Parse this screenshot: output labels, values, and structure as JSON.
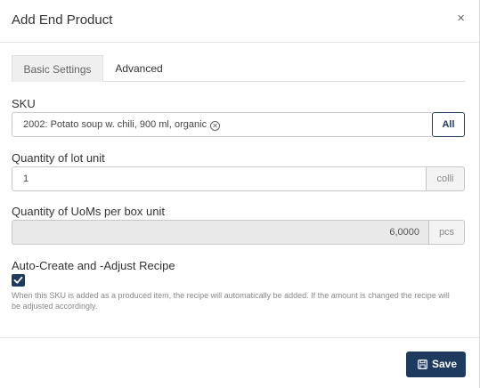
{
  "dialog": {
    "title": "Add End Product",
    "close_glyph": "×"
  },
  "tabs": [
    {
      "label": "Basic Settings",
      "active": true
    },
    {
      "label": "Advanced",
      "active": false
    }
  ],
  "sku": {
    "label": "SKU",
    "value": "2002: Potato soup w. chili, 900 ml, organic",
    "clear_glyph": "✕",
    "button_label": "All"
  },
  "lot_quantity": {
    "label": "Quantity of lot unit",
    "value": "1",
    "unit": "colli"
  },
  "box_quantity": {
    "label": "Quantity of UoMs per box unit",
    "value": "6,0000",
    "unit": "pcs"
  },
  "recipe": {
    "label": "Auto-Create and -Adjust Recipe",
    "checked": true,
    "help": "When this SKU is added as a produced item, the recipe will automatically be added. If the amount is changed the recipe will be adjusted accordingly."
  },
  "footer": {
    "save_label": "Save",
    "save_icon": "save-icon"
  },
  "colors": {
    "primary": "#1f3a5f"
  }
}
